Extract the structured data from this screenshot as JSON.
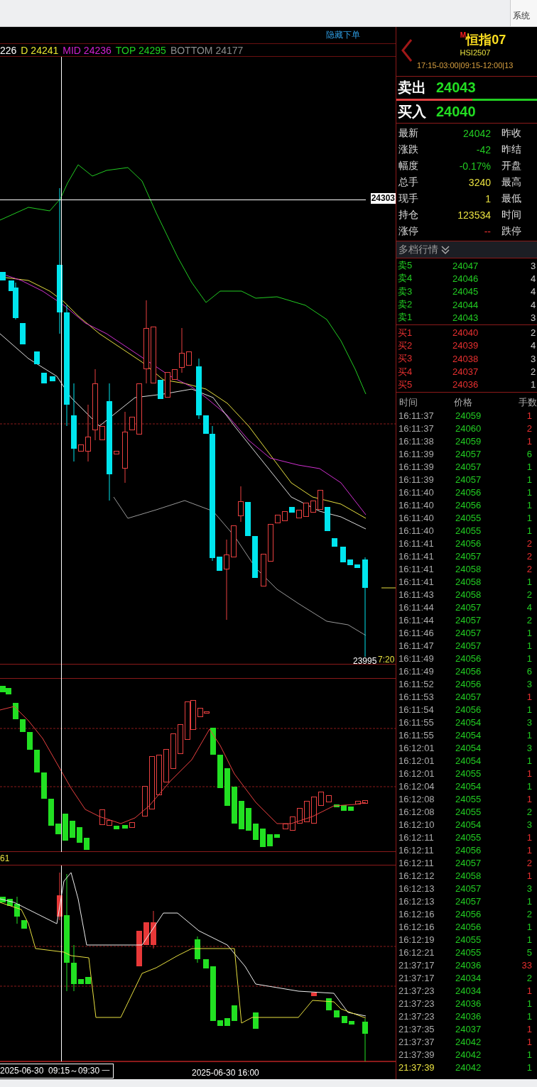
{
  "top_bar": {
    "menu_label": "系统"
  },
  "chart": {
    "hide_order_link": "隐藏下单",
    "indicators": [
      {
        "text": "226",
        "color": "#ffffff"
      },
      {
        "text": "D 24241",
        "color": "#e8e830"
      },
      {
        "text": "MID 24236",
        "color": "#d020d0"
      },
      {
        "text": "TOP 24295",
        "color": "#20d020"
      },
      {
        "text": "BOTTOM 24177",
        "color": "#8c8c8c"
      }
    ],
    "crosshair_price": "24303",
    "low_label": "23995",
    "countdown": "7:20",
    "panel_3_label": "61",
    "crosshair_time": "2025-06-30  09:15～09:30 一",
    "axis_label": "2025-06-30 16:00"
  },
  "quote": {
    "flag": "M",
    "name": "恒指07",
    "code": "HSI2507",
    "hours": "17:15-03:00|09:15-12:00|13",
    "ask": {
      "label": "卖出",
      "price": "24043"
    },
    "ratio_bar": {
      "level": 0.54
    },
    "bid": {
      "label": "买入",
      "price": "24040"
    },
    "stats": [
      {
        "label": "最新",
        "value": "24042",
        "color": "#22cc22",
        "label_2": "昨收"
      },
      {
        "label": "涨跌",
        "value": "-42",
        "color": "#22cc22",
        "label_2": "昨结"
      },
      {
        "label": "幅度",
        "value": "-0.17%",
        "color": "#22cc22",
        "label_2": "开盘"
      },
      {
        "label": "总手",
        "value": "3240",
        "color": "#e8e040",
        "label_2": "最高"
      },
      {
        "label": "现手",
        "value": "1",
        "color": "#e8e040",
        "label_2": "最低"
      },
      {
        "label": "持仓",
        "value": "123534",
        "color": "#e8e040",
        "label_2": "时间"
      },
      {
        "label": "涨停",
        "value": "--",
        "color": "#e83030",
        "label_2": "跌停"
      }
    ]
  },
  "depth": {
    "title": "多档行情",
    "asks": [
      {
        "label": "卖5",
        "price": "24047",
        "volume": "3"
      },
      {
        "label": "卖4",
        "price": "24046",
        "volume": "4"
      },
      {
        "label": "卖3",
        "price": "24045",
        "volume": "4"
      },
      {
        "label": "卖2",
        "price": "24044",
        "volume": "4"
      },
      {
        "label": "卖1",
        "price": "24043",
        "volume": "3"
      }
    ],
    "bids": [
      {
        "label": "买1",
        "price": "24040",
        "volume": "2"
      },
      {
        "label": "买2",
        "price": "24039",
        "volume": "4"
      },
      {
        "label": "买3",
        "price": "24038",
        "volume": "3"
      },
      {
        "label": "买4",
        "price": "24037",
        "volume": "2"
      },
      {
        "label": "买5",
        "price": "24036",
        "volume": "1"
      }
    ]
  },
  "ticks": {
    "columns": [
      "时间",
      "价格",
      "手数"
    ],
    "rows": [
      {
        "time": "16:11:37",
        "price": "24059",
        "volume": "1",
        "color": "#e83030",
        "latest": false
      },
      {
        "time": "16:11:37",
        "price": "24060",
        "volume": "2",
        "color": "#e83030",
        "latest": false
      },
      {
        "time": "16:11:38",
        "price": "24059",
        "volume": "1",
        "color": "#e83030",
        "latest": false
      },
      {
        "time": "16:11:39",
        "price": "24057",
        "volume": "6",
        "color": "#22cc22",
        "latest": false
      },
      {
        "time": "16:11:39",
        "price": "24057",
        "volume": "1",
        "color": "#22cc22",
        "latest": false
      },
      {
        "time": "16:11:39",
        "price": "24057",
        "volume": "1",
        "color": "#22cc22",
        "latest": false
      },
      {
        "time": "16:11:40",
        "price": "24056",
        "volume": "1",
        "color": "#22cc22",
        "latest": false
      },
      {
        "time": "16:11:40",
        "price": "24056",
        "volume": "1",
        "color": "#22cc22",
        "latest": false
      },
      {
        "time": "16:11:40",
        "price": "24055",
        "volume": "1",
        "color": "#22cc22",
        "latest": false
      },
      {
        "time": "16:11:40",
        "price": "24055",
        "volume": "1",
        "color": "#22cc22",
        "latest": false
      },
      {
        "time": "16:11:41",
        "price": "24056",
        "volume": "2",
        "color": "#e83030",
        "latest": false
      },
      {
        "time": "16:11:41",
        "price": "24057",
        "volume": "2",
        "color": "#e83030",
        "latest": false
      },
      {
        "time": "16:11:41",
        "price": "24058",
        "volume": "2",
        "color": "#e83030",
        "latest": false
      },
      {
        "time": "16:11:41",
        "price": "24058",
        "volume": "1",
        "color": "#22cc22",
        "latest": false
      },
      {
        "time": "16:11:43",
        "price": "24058",
        "volume": "2",
        "color": "#22cc22",
        "latest": false
      },
      {
        "time": "16:11:44",
        "price": "24057",
        "volume": "4",
        "color": "#22cc22",
        "latest": false
      },
      {
        "time": "16:11:44",
        "price": "24057",
        "volume": "2",
        "color": "#22cc22",
        "latest": false
      },
      {
        "time": "16:11:46",
        "price": "24057",
        "volume": "1",
        "color": "#22cc22",
        "latest": false
      },
      {
        "time": "16:11:47",
        "price": "24057",
        "volume": "1",
        "color": "#22cc22",
        "latest": false
      },
      {
        "time": "16:11:49",
        "price": "24056",
        "volume": "1",
        "color": "#22cc22",
        "latest": false
      },
      {
        "time": "16:11:49",
        "price": "24056",
        "volume": "6",
        "color": "#22cc22",
        "latest": false
      },
      {
        "time": "16:11:52",
        "price": "24056",
        "volume": "3",
        "color": "#22cc22",
        "latest": false
      },
      {
        "time": "16:11:53",
        "price": "24057",
        "volume": "1",
        "color": "#e83030",
        "latest": false
      },
      {
        "time": "16:11:54",
        "price": "24056",
        "volume": "1",
        "color": "#22cc22",
        "latest": false
      },
      {
        "time": "16:11:55",
        "price": "24054",
        "volume": "3",
        "color": "#22cc22",
        "latest": false
      },
      {
        "time": "16:11:55",
        "price": "24054",
        "volume": "1",
        "color": "#22cc22",
        "latest": false
      },
      {
        "time": "16:12:01",
        "price": "24054",
        "volume": "3",
        "color": "#22cc22",
        "latest": false
      },
      {
        "time": "16:12:01",
        "price": "24054",
        "volume": "1",
        "color": "#22cc22",
        "latest": false
      },
      {
        "time": "16:12:01",
        "price": "24055",
        "volume": "1",
        "color": "#e83030",
        "latest": false
      },
      {
        "time": "16:12:04",
        "price": "24054",
        "volume": "1",
        "color": "#22cc22",
        "latest": false
      },
      {
        "time": "16:12:08",
        "price": "24055",
        "volume": "1",
        "color": "#e83030",
        "latest": false
      },
      {
        "time": "16:12:08",
        "price": "24055",
        "volume": "2",
        "color": "#22cc22",
        "latest": false
      },
      {
        "time": "16:12:10",
        "price": "24054",
        "volume": "3",
        "color": "#22cc22",
        "latest": false
      },
      {
        "time": "16:12:11",
        "price": "24055",
        "volume": "1",
        "color": "#e83030",
        "latest": false
      },
      {
        "time": "16:12:11",
        "price": "24056",
        "volume": "1",
        "color": "#e83030",
        "latest": false
      },
      {
        "time": "16:12:11",
        "price": "24057",
        "volume": "2",
        "color": "#e83030",
        "latest": false
      },
      {
        "time": "16:12:12",
        "price": "24058",
        "volume": "1",
        "color": "#e83030",
        "latest": false
      },
      {
        "time": "16:12:13",
        "price": "24057",
        "volume": "3",
        "color": "#22cc22",
        "latest": false
      },
      {
        "time": "16:12:13",
        "price": "24057",
        "volume": "1",
        "color": "#22cc22",
        "latest": false
      },
      {
        "time": "16:12:16",
        "price": "24056",
        "volume": "2",
        "color": "#22cc22",
        "latest": false
      },
      {
        "time": "16:12:16",
        "price": "24056",
        "volume": "1",
        "color": "#22cc22",
        "latest": false
      },
      {
        "time": "16:12:19",
        "price": "24055",
        "volume": "1",
        "color": "#22cc22",
        "latest": false
      },
      {
        "time": "16:12:21",
        "price": "24055",
        "volume": "5",
        "color": "#22cc22",
        "latest": false
      },
      {
        "time": "21:37:17",
        "price": "24036",
        "volume": "33",
        "color": "#e83030",
        "latest": false
      },
      {
        "time": "21:37:17",
        "price": "24034",
        "volume": "2",
        "color": "#22cc22",
        "latest": false
      },
      {
        "time": "21:37:23",
        "price": "24034",
        "volume": "1",
        "color": "#e83030",
        "latest": false
      },
      {
        "time": "21:37:23",
        "price": "24036",
        "volume": "1",
        "color": "#22cc22",
        "latest": false
      },
      {
        "time": "21:37:23",
        "price": "24036",
        "volume": "1",
        "color": "#22cc22",
        "latest": false
      },
      {
        "time": "21:37:35",
        "price": "24037",
        "volume": "1",
        "color": "#e83030",
        "latest": false
      },
      {
        "time": "21:37:37",
        "price": "24042",
        "volume": "1",
        "color": "#e83030",
        "latest": false
      },
      {
        "time": "21:37:39",
        "price": "24042",
        "volume": "1",
        "color": "#22cc22",
        "latest": false
      },
      {
        "time": "21:37:39",
        "price": "24042",
        "volume": "1",
        "color": "#22cc22",
        "latest": true
      }
    ]
  }
}
